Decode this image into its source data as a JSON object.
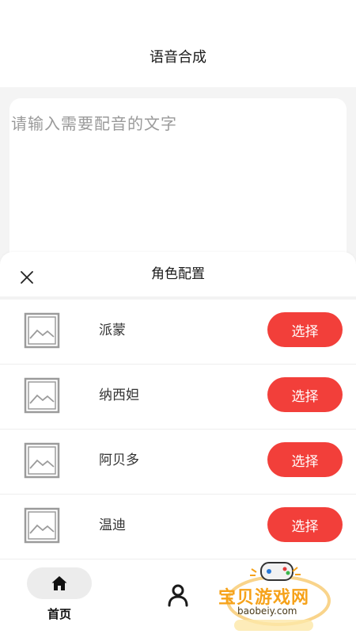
{
  "header": {
    "title": "语音合成"
  },
  "text_input": {
    "placeholder": "请输入需要配音的文字"
  },
  "sheet": {
    "title": "角色配置",
    "roles": [
      {
        "name": "派蒙",
        "button": "选择"
      },
      {
        "name": "纳西妲",
        "button": "选择"
      },
      {
        "name": "阿贝多",
        "button": "选择"
      },
      {
        "name": "温迪",
        "button": "选择"
      }
    ]
  },
  "nav": {
    "home_label": "首页"
  },
  "watermark": {
    "text": "宝贝游戏网",
    "url": "baobeiy.com"
  },
  "colors": {
    "accent": "#f23f3a",
    "watermark": "#f6a21a"
  }
}
